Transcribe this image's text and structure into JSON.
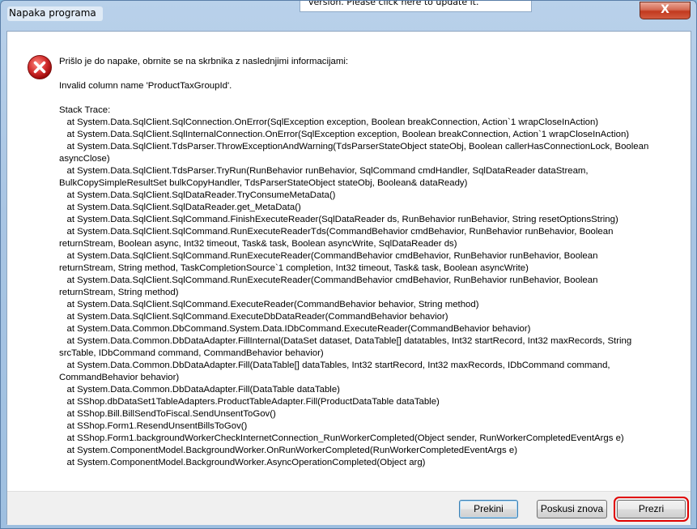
{
  "window": {
    "title": "Napaka programa",
    "update_notice": "version. Please click here to update it.",
    "close_symbol": "X"
  },
  "icon": "error-icon",
  "message_lines": [
    "Prišlo je do napake, obrnite se na skrbnika z naslednjimi informacijami:",
    "",
    "Invalid column name 'ProductTaxGroupId'.",
    "",
    "Stack Trace:",
    "   at System.Data.SqlClient.SqlConnection.OnError(SqlException exception, Boolean breakConnection, Action`1 wrapCloseInAction)",
    "   at System.Data.SqlClient.SqlInternalConnection.OnError(SqlException exception, Boolean breakConnection, Action`1 wrapCloseInAction)",
    "   at System.Data.SqlClient.TdsParser.ThrowExceptionAndWarning(TdsParserStateObject stateObj, Boolean callerHasConnectionLock, Boolean",
    "asyncClose)",
    "   at System.Data.SqlClient.TdsParser.TryRun(RunBehavior runBehavior, SqlCommand cmdHandler, SqlDataReader dataStream,",
    "BulkCopySimpleResultSet bulkCopyHandler, TdsParserStateObject stateObj, Boolean& dataReady)",
    "   at System.Data.SqlClient.SqlDataReader.TryConsumeMetaData()",
    "   at System.Data.SqlClient.SqlDataReader.get_MetaData()",
    "   at System.Data.SqlClient.SqlCommand.FinishExecuteReader(SqlDataReader ds, RunBehavior runBehavior, String resetOptionsString)",
    "   at System.Data.SqlClient.SqlCommand.RunExecuteReaderTds(CommandBehavior cmdBehavior, RunBehavior runBehavior, Boolean",
    "returnStream, Boolean async, Int32 timeout, Task& task, Boolean asyncWrite, SqlDataReader ds)",
    "   at System.Data.SqlClient.SqlCommand.RunExecuteReader(CommandBehavior cmdBehavior, RunBehavior runBehavior, Boolean",
    "returnStream, String method, TaskCompletionSource`1 completion, Int32 timeout, Task& task, Boolean asyncWrite)",
    "   at System.Data.SqlClient.SqlCommand.RunExecuteReader(CommandBehavior cmdBehavior, RunBehavior runBehavior, Boolean",
    "returnStream, String method)",
    "   at System.Data.SqlClient.SqlCommand.ExecuteReader(CommandBehavior behavior, String method)",
    "   at System.Data.SqlClient.SqlCommand.ExecuteDbDataReader(CommandBehavior behavior)",
    "   at System.Data.Common.DbCommand.System.Data.IDbCommand.ExecuteReader(CommandBehavior behavior)",
    "   at System.Data.Common.DbDataAdapter.FillInternal(DataSet dataset, DataTable[] datatables, Int32 startRecord, Int32 maxRecords, String",
    "srcTable, IDbCommand command, CommandBehavior behavior)",
    "   at System.Data.Common.DbDataAdapter.Fill(DataTable[] dataTables, Int32 startRecord, Int32 maxRecords, IDbCommand command,",
    "CommandBehavior behavior)",
    "   at System.Data.Common.DbDataAdapter.Fill(DataTable dataTable)",
    "   at SShop.dbDataSet1TableAdapters.ProductTableAdapter.Fill(ProductDataTable dataTable)",
    "   at SShop.Bill.BillSendToFiscal.SendUnsentToGov()",
    "   at SShop.Form1.ResendUnsentBillsToGov()",
    "   at SShop.Form1.backgroundWorkerCheckInternetConnection_RunWorkerCompleted(Object sender, RunWorkerCompletedEventArgs e)",
    "   at System.ComponentModel.BackgroundWorker.OnRunWorkerCompleted(RunWorkerCompletedEventArgs e)",
    "   at System.ComponentModel.BackgroundWorker.AsyncOperationCompleted(Object arg)"
  ],
  "buttons": {
    "abort": "Prekini",
    "retry": "Poskusi znova",
    "ignore": "Prezri"
  },
  "colors": {
    "highlight": "#e00000",
    "error_red": "#c8102e"
  }
}
